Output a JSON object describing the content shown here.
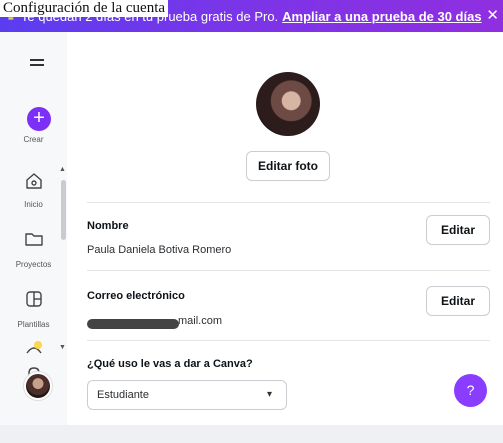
{
  "banner": {
    "text": "Te quedan 2 días en tu prueba gratis de Pro.",
    "link": "Ampliar a una prueba de 30 días",
    "close": "✕",
    "crown_icon": "crown-icon"
  },
  "overlay": {
    "text": "Configuración de la cuenta"
  },
  "sidebar": {
    "create_label": "Crear",
    "items": [
      {
        "label": "Inicio",
        "icon": "home-icon"
      },
      {
        "label": "Proyectos",
        "icon": "folder-icon"
      },
      {
        "label": "Plantillas",
        "icon": "templates-icon"
      }
    ]
  },
  "profile": {
    "edit_photo": "Editar foto",
    "name_label": "Nombre",
    "name_value": "Paula Daniela Botiva Romero",
    "email_label": "Correo electrónico",
    "email_value": "mail.com",
    "edit_label": "Editar",
    "use_label": "¿Qué uso le vas a dar a Canva?",
    "use_value": "Estudiante"
  },
  "help": {
    "label": "?"
  },
  "colors": {
    "accent": "#7b2ff7",
    "banner": "#6a38ee"
  }
}
